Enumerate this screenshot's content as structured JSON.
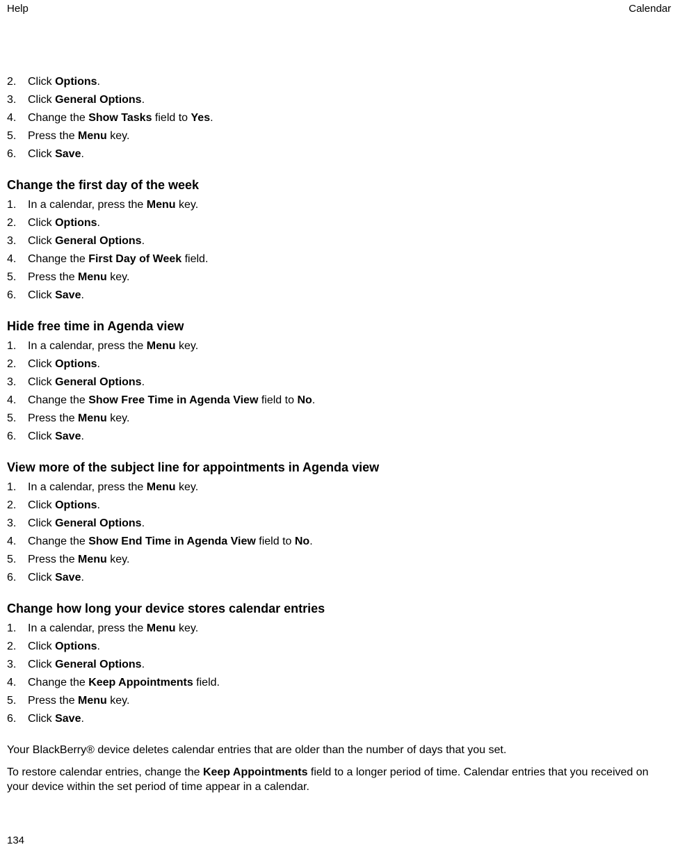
{
  "header": {
    "left": "Help",
    "right": "Calendar"
  },
  "pageNumber": "134",
  "intro": [
    {
      "n": "2.",
      "parts": [
        "Click ",
        {
          "b": "Options"
        },
        "."
      ]
    },
    {
      "n": "3.",
      "parts": [
        "Click ",
        {
          "b": "General Options"
        },
        "."
      ]
    },
    {
      "n": "4.",
      "parts": [
        "Change the ",
        {
          "b": "Show Tasks"
        },
        " field to ",
        {
          "b": "Yes"
        },
        "."
      ]
    },
    {
      "n": "5.",
      "parts": [
        "Press the ",
        {
          "b": "Menu"
        },
        " key."
      ]
    },
    {
      "n": "6.",
      "parts": [
        "Click ",
        {
          "b": "Save"
        },
        "."
      ]
    }
  ],
  "sections": [
    {
      "heading": "Change the first day of the week",
      "steps": [
        {
          "n": "1.",
          "parts": [
            "In a calendar, press the ",
            {
              "b": "Menu"
            },
            " key."
          ]
        },
        {
          "n": "2.",
          "parts": [
            "Click ",
            {
              "b": "Options"
            },
            "."
          ]
        },
        {
          "n": "3.",
          "parts": [
            "Click ",
            {
              "b": "General Options"
            },
            "."
          ]
        },
        {
          "n": "4.",
          "parts": [
            "Change the ",
            {
              "b": "First Day of Week"
            },
            " field."
          ]
        },
        {
          "n": "5.",
          "parts": [
            "Press the ",
            {
              "b": "Menu"
            },
            " key."
          ]
        },
        {
          "n": "6.",
          "parts": [
            "Click ",
            {
              "b": "Save"
            },
            "."
          ]
        }
      ]
    },
    {
      "heading": "Hide free time in Agenda view",
      "steps": [
        {
          "n": "1.",
          "parts": [
            "In a calendar, press the ",
            {
              "b": "Menu"
            },
            " key."
          ]
        },
        {
          "n": "2.",
          "parts": [
            "Click ",
            {
              "b": "Options"
            },
            "."
          ]
        },
        {
          "n": "3.",
          "parts": [
            "Click ",
            {
              "b": "General Options"
            },
            "."
          ]
        },
        {
          "n": "4.",
          "parts": [
            "Change the ",
            {
              "b": "Show Free Time in Agenda View"
            },
            " field to ",
            {
              "b": "No"
            },
            "."
          ]
        },
        {
          "n": "5.",
          "parts": [
            "Press the ",
            {
              "b": "Menu"
            },
            " key."
          ]
        },
        {
          "n": "6.",
          "parts": [
            "Click ",
            {
              "b": "Save"
            },
            "."
          ]
        }
      ]
    },
    {
      "heading": "View more of the subject line for appointments in Agenda view",
      "steps": [
        {
          "n": "1.",
          "parts": [
            "In a calendar, press the ",
            {
              "b": "Menu"
            },
            " key."
          ]
        },
        {
          "n": "2.",
          "parts": [
            "Click ",
            {
              "b": "Options"
            },
            "."
          ]
        },
        {
          "n": "3.",
          "parts": [
            "Click ",
            {
              "b": "General Options"
            },
            "."
          ]
        },
        {
          "n": "4.",
          "parts": [
            "Change the ",
            {
              "b": "Show End Time in Agenda View"
            },
            " field to ",
            {
              "b": "No"
            },
            "."
          ]
        },
        {
          "n": "5.",
          "parts": [
            "Press the ",
            {
              "b": "Menu"
            },
            " key."
          ]
        },
        {
          "n": "6.",
          "parts": [
            "Click ",
            {
              "b": "Save"
            },
            "."
          ]
        }
      ]
    },
    {
      "heading": "Change how long your device stores calendar entries",
      "steps": [
        {
          "n": "1.",
          "parts": [
            "In a calendar, press the ",
            {
              "b": "Menu"
            },
            " key."
          ]
        },
        {
          "n": "2.",
          "parts": [
            "Click ",
            {
              "b": "Options"
            },
            "."
          ]
        },
        {
          "n": "3.",
          "parts": [
            "Click ",
            {
              "b": "General Options"
            },
            "."
          ]
        },
        {
          "n": "4.",
          "parts": [
            "Change the ",
            {
              "b": "Keep Appointments"
            },
            " field."
          ]
        },
        {
          "n": "5.",
          "parts": [
            "Press the ",
            {
              "b": "Menu"
            },
            " key."
          ]
        },
        {
          "n": "6.",
          "parts": [
            "Click ",
            {
              "b": "Save"
            },
            "."
          ]
        }
      ],
      "paras": [
        {
          "parts": [
            "Your BlackBerry® device deletes calendar entries that are older than the number of days that you set."
          ]
        },
        {
          "parts": [
            "To restore calendar entries, change the ",
            {
              "b": "Keep Appointments"
            },
            " field to a longer period of time. Calendar entries that you received on your device within the set period of time appear in a calendar."
          ]
        }
      ]
    }
  ]
}
